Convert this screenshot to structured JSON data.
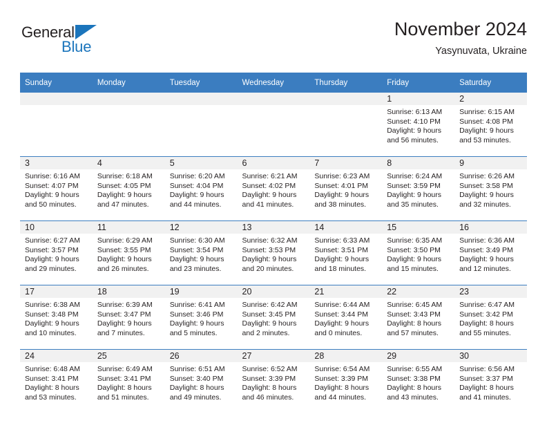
{
  "brand": {
    "line1": "General",
    "line2": "Blue",
    "icon": "triangle-logo-icon",
    "color_dark": "#231f20",
    "color_blue": "#1b75bc"
  },
  "header": {
    "title": "November 2024",
    "subtitle": "Yasynuvata, Ukraine"
  },
  "theme": {
    "header_bg": "#3b7dc0",
    "daynum_bg": "#f1f1f1",
    "cell_bg": "#ffffff",
    "text": "#231f20"
  },
  "calendar": {
    "weekdays": [
      "Sunday",
      "Monday",
      "Tuesday",
      "Wednesday",
      "Thursday",
      "Friday",
      "Saturday"
    ],
    "weeks": [
      [
        {
          "day": "",
          "lines": [
            "",
            "",
            "",
            ""
          ]
        },
        {
          "day": "",
          "lines": [
            "",
            "",
            "",
            ""
          ]
        },
        {
          "day": "",
          "lines": [
            "",
            "",
            "",
            ""
          ]
        },
        {
          "day": "",
          "lines": [
            "",
            "",
            "",
            ""
          ]
        },
        {
          "day": "",
          "lines": [
            "",
            "",
            "",
            ""
          ]
        },
        {
          "day": "1",
          "lines": [
            "Sunrise: 6:13 AM",
            "Sunset: 4:10 PM",
            "Daylight: 9 hours",
            "and 56 minutes."
          ]
        },
        {
          "day": "2",
          "lines": [
            "Sunrise: 6:15 AM",
            "Sunset: 4:08 PM",
            "Daylight: 9 hours",
            "and 53 minutes."
          ]
        }
      ],
      [
        {
          "day": "3",
          "lines": [
            "Sunrise: 6:16 AM",
            "Sunset: 4:07 PM",
            "Daylight: 9 hours",
            "and 50 minutes."
          ]
        },
        {
          "day": "4",
          "lines": [
            "Sunrise: 6:18 AM",
            "Sunset: 4:05 PM",
            "Daylight: 9 hours",
            "and 47 minutes."
          ]
        },
        {
          "day": "5",
          "lines": [
            "Sunrise: 6:20 AM",
            "Sunset: 4:04 PM",
            "Daylight: 9 hours",
            "and 44 minutes."
          ]
        },
        {
          "day": "6",
          "lines": [
            "Sunrise: 6:21 AM",
            "Sunset: 4:02 PM",
            "Daylight: 9 hours",
            "and 41 minutes."
          ]
        },
        {
          "day": "7",
          "lines": [
            "Sunrise: 6:23 AM",
            "Sunset: 4:01 PM",
            "Daylight: 9 hours",
            "and 38 minutes."
          ]
        },
        {
          "day": "8",
          "lines": [
            "Sunrise: 6:24 AM",
            "Sunset: 3:59 PM",
            "Daylight: 9 hours",
            "and 35 minutes."
          ]
        },
        {
          "day": "9",
          "lines": [
            "Sunrise: 6:26 AM",
            "Sunset: 3:58 PM",
            "Daylight: 9 hours",
            "and 32 minutes."
          ]
        }
      ],
      [
        {
          "day": "10",
          "lines": [
            "Sunrise: 6:27 AM",
            "Sunset: 3:57 PM",
            "Daylight: 9 hours",
            "and 29 minutes."
          ]
        },
        {
          "day": "11",
          "lines": [
            "Sunrise: 6:29 AM",
            "Sunset: 3:55 PM",
            "Daylight: 9 hours",
            "and 26 minutes."
          ]
        },
        {
          "day": "12",
          "lines": [
            "Sunrise: 6:30 AM",
            "Sunset: 3:54 PM",
            "Daylight: 9 hours",
            "and 23 minutes."
          ]
        },
        {
          "day": "13",
          "lines": [
            "Sunrise: 6:32 AM",
            "Sunset: 3:53 PM",
            "Daylight: 9 hours",
            "and 20 minutes."
          ]
        },
        {
          "day": "14",
          "lines": [
            "Sunrise: 6:33 AM",
            "Sunset: 3:51 PM",
            "Daylight: 9 hours",
            "and 18 minutes."
          ]
        },
        {
          "day": "15",
          "lines": [
            "Sunrise: 6:35 AM",
            "Sunset: 3:50 PM",
            "Daylight: 9 hours",
            "and 15 minutes."
          ]
        },
        {
          "day": "16",
          "lines": [
            "Sunrise: 6:36 AM",
            "Sunset: 3:49 PM",
            "Daylight: 9 hours",
            "and 12 minutes."
          ]
        }
      ],
      [
        {
          "day": "17",
          "lines": [
            "Sunrise: 6:38 AM",
            "Sunset: 3:48 PM",
            "Daylight: 9 hours",
            "and 10 minutes."
          ]
        },
        {
          "day": "18",
          "lines": [
            "Sunrise: 6:39 AM",
            "Sunset: 3:47 PM",
            "Daylight: 9 hours",
            "and 7 minutes."
          ]
        },
        {
          "day": "19",
          "lines": [
            "Sunrise: 6:41 AM",
            "Sunset: 3:46 PM",
            "Daylight: 9 hours",
            "and 5 minutes."
          ]
        },
        {
          "day": "20",
          "lines": [
            "Sunrise: 6:42 AM",
            "Sunset: 3:45 PM",
            "Daylight: 9 hours",
            "and 2 minutes."
          ]
        },
        {
          "day": "21",
          "lines": [
            "Sunrise: 6:44 AM",
            "Sunset: 3:44 PM",
            "Daylight: 9 hours",
            "and 0 minutes."
          ]
        },
        {
          "day": "22",
          "lines": [
            "Sunrise: 6:45 AM",
            "Sunset: 3:43 PM",
            "Daylight: 8 hours",
            "and 57 minutes."
          ]
        },
        {
          "day": "23",
          "lines": [
            "Sunrise: 6:47 AM",
            "Sunset: 3:42 PM",
            "Daylight: 8 hours",
            "and 55 minutes."
          ]
        }
      ],
      [
        {
          "day": "24",
          "lines": [
            "Sunrise: 6:48 AM",
            "Sunset: 3:41 PM",
            "Daylight: 8 hours",
            "and 53 minutes."
          ]
        },
        {
          "day": "25",
          "lines": [
            "Sunrise: 6:49 AM",
            "Sunset: 3:41 PM",
            "Daylight: 8 hours",
            "and 51 minutes."
          ]
        },
        {
          "day": "26",
          "lines": [
            "Sunrise: 6:51 AM",
            "Sunset: 3:40 PM",
            "Daylight: 8 hours",
            "and 49 minutes."
          ]
        },
        {
          "day": "27",
          "lines": [
            "Sunrise: 6:52 AM",
            "Sunset: 3:39 PM",
            "Daylight: 8 hours",
            "and 46 minutes."
          ]
        },
        {
          "day": "28",
          "lines": [
            "Sunrise: 6:54 AM",
            "Sunset: 3:39 PM",
            "Daylight: 8 hours",
            "and 44 minutes."
          ]
        },
        {
          "day": "29",
          "lines": [
            "Sunrise: 6:55 AM",
            "Sunset: 3:38 PM",
            "Daylight: 8 hours",
            "and 43 minutes."
          ]
        },
        {
          "day": "30",
          "lines": [
            "Sunrise: 6:56 AM",
            "Sunset: 3:37 PM",
            "Daylight: 8 hours",
            "and 41 minutes."
          ]
        }
      ]
    ]
  }
}
